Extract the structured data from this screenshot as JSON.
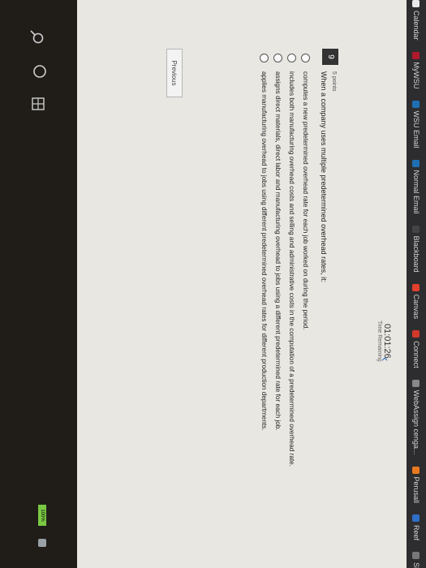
{
  "bookmarks": [
    {
      "label": "Calendar",
      "color": "#e8e8e8"
    },
    {
      "label": "MyWSU",
      "color": "#b0182c"
    },
    {
      "label": "WSU Email",
      "color": "#1f6fb5"
    },
    {
      "label": "Normal Email",
      "color": "#1f6fb5"
    },
    {
      "label": "Blackboard",
      "color": "#444444"
    },
    {
      "label": "Canvas",
      "color": "#e1402d"
    },
    {
      "label": "Connect",
      "color": "#d3382b"
    },
    {
      "label": "WebAssign cenga...",
      "color": "#888888"
    },
    {
      "label": "Perusall",
      "color": "#e8791f"
    },
    {
      "label": "Reef",
      "color": "#2f6fc7"
    },
    {
      "label": "Skynet",
      "color": "#777777"
    }
  ],
  "timer": {
    "value": "01:01:26",
    "label": "Time Remaining"
  },
  "question": {
    "number": "9",
    "points": "5 points",
    "prompt": "When a company uses multiple predetermined overhead rates, it:",
    "answers": [
      "computes a new predetermined overhead rate for each job worked on during the period.",
      "includes both manufacturing overhead costs and selling and administrative costs in the computation of a predetermined overhead rate.",
      "assigns direct materials, direct labor and manufacturing overhead to jobs using a different predetermined rate for each job.",
      "applies manufacturing overhead to jobs using different predetermined overhead rates for different production departments."
    ]
  },
  "navigation": {
    "previous_label": "Previous"
  },
  "taskbar": {
    "battery_label": "100%"
  }
}
